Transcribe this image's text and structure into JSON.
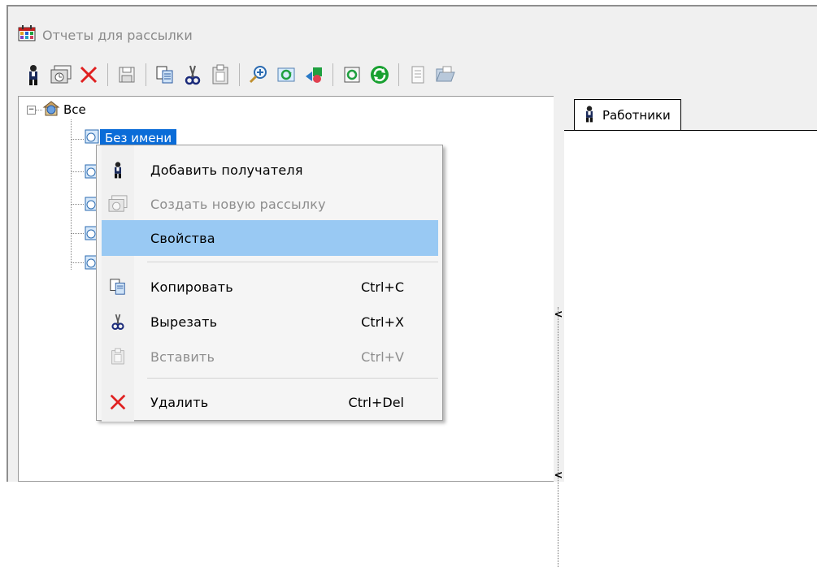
{
  "window": {
    "title": "Отчеты для рассылки"
  },
  "toolbar": {
    "groups": [
      [
        "user-add-icon",
        "new-mailing-icon",
        "delete-x-icon"
      ],
      [
        "save-disk-icon"
      ],
      [
        "copy-icon",
        "cut-scissors-icon",
        "paste-clipboard-icon"
      ],
      [
        "zoom-plus-icon",
        "refresh-window-icon",
        "shapes-icon"
      ],
      [
        "reload-icon",
        "sync-green-icon"
      ],
      [
        "document-icon",
        "folder-open-icon"
      ]
    ]
  },
  "tree": {
    "root_label": "Все",
    "root_expander": "−",
    "selected_item": "Без имени",
    "child_count": 5
  },
  "right_panel": {
    "tab_label": "Работники"
  },
  "context_menu": {
    "items": [
      {
        "label": "Добавить получателя",
        "shortcut": "",
        "icon": "user-add-icon",
        "disabled": false
      },
      {
        "label": "Создать новую рассылку",
        "shortcut": "",
        "icon": "new-mailing-icon",
        "disabled": true
      },
      {
        "label": "Свойства",
        "shortcut": "",
        "icon": "",
        "disabled": false,
        "highlighted": true
      },
      {
        "label": "Копировать",
        "shortcut": "Ctrl+C",
        "icon": "copy-icon",
        "disabled": false
      },
      {
        "label": "Вырезать",
        "shortcut": "Ctrl+X",
        "icon": "cut-scissors-icon",
        "disabled": false
      },
      {
        "label": "Вставить",
        "shortcut": "Ctrl+V",
        "icon": "paste-clipboard-icon",
        "disabled": true
      },
      {
        "label": "Удалить",
        "shortcut": "Ctrl+Del",
        "icon": "delete-x-icon",
        "disabled": false
      }
    ]
  },
  "splitter": {
    "arrow": "<"
  },
  "colors": {
    "selection": "#0a6cd8",
    "menu_highlight": "#99c9f3",
    "delete_red": "#e02020"
  }
}
